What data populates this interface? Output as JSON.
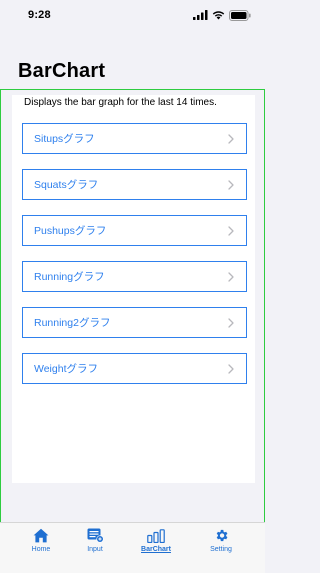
{
  "status_bar": {
    "time": "9:28"
  },
  "header": {
    "title": "BarChart"
  },
  "content": {
    "description": "Displays the bar graph for the last 14 times.",
    "items": [
      {
        "label": "Situpsグラフ"
      },
      {
        "label": "Squatsグラフ"
      },
      {
        "label": "Pushupsグラフ"
      },
      {
        "label": "Runningグラフ"
      },
      {
        "label": "Running2グラフ"
      },
      {
        "label": "Weightグラフ"
      }
    ]
  },
  "tab_bar": {
    "tabs": [
      {
        "label": "Home",
        "icon": "house-icon"
      },
      {
        "label": "Input",
        "icon": "input-icon"
      },
      {
        "label": "BarChart",
        "icon": "bar-chart-icon",
        "active": true
      },
      {
        "label": "Setting",
        "icon": "gear-icon"
      }
    ]
  },
  "colors": {
    "accent": "#2f80ed",
    "frame": "#2ecc40",
    "tab_tint": "#1f6fd1"
  }
}
